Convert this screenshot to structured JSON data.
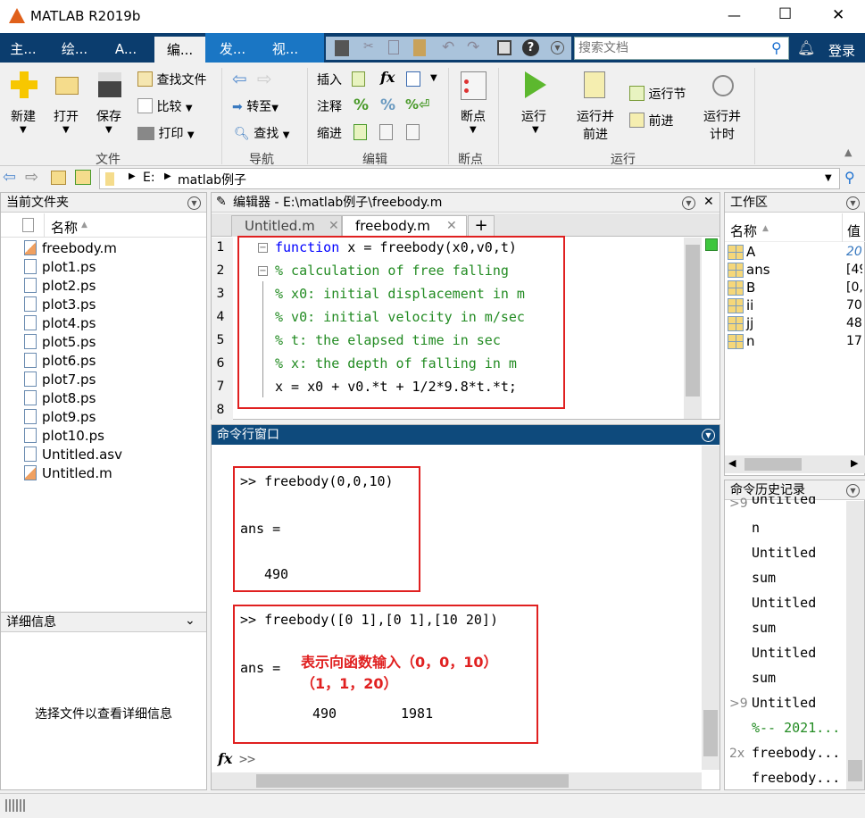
{
  "window": {
    "title": "MATLAB R2019b",
    "minimize": "—",
    "maximize": "☐",
    "close": "✕"
  },
  "tabs": [
    {
      "label": "主..."
    },
    {
      "label": "绘..."
    },
    {
      "label": "A..."
    },
    {
      "label": "编..."
    },
    {
      "label": "发..."
    },
    {
      "label": "视..."
    }
  ],
  "search": {
    "placeholder": "搜索文档"
  },
  "login": "登录",
  "ribbon": {
    "file": {
      "new": "新建",
      "open": "打开",
      "save": "保存",
      "find_files": "查找文件",
      "compare": "比较",
      "print": "打印",
      "group": "文件"
    },
    "nav": {
      "goto": "转至",
      "find": "查找",
      "group": "导航"
    },
    "edit": {
      "insert": "插入",
      "comment": "注释",
      "indent": "缩进",
      "group": "编辑"
    },
    "breakpoints": {
      "label": "断点",
      "group": "断点"
    },
    "run": {
      "run": "运行",
      "run_advance_1": "运行并",
      "run_advance_2": "前进",
      "run_section": "运行节",
      "advance": "前进",
      "run_time_1": "运行并",
      "run_time_2": "计时",
      "group": "运行"
    }
  },
  "address": {
    "drive": "E:",
    "folder": "matlab例子"
  },
  "current_folder": {
    "title": "当前文件夹",
    "column": "名称",
    "files": [
      "freebody.m",
      "plot1.ps",
      "plot2.ps",
      "plot3.ps",
      "plot4.ps",
      "plot5.ps",
      "plot6.ps",
      "plot7.ps",
      "plot8.ps",
      "plot9.ps",
      "plot10.ps",
      "Untitled.asv",
      "Untitled.m"
    ]
  },
  "details": {
    "title": "详细信息",
    "message": "选择文件以查看详细信息"
  },
  "editor": {
    "title": "编辑器 - E:\\matlab例子\\freebody.m",
    "tabs": [
      "Untitled.m",
      "freebody.m"
    ],
    "active_tab": 1,
    "lines": [
      {
        "n": "1",
        "kw": "function",
        "text": " x = freebody(x0,v0,t)"
      },
      {
        "n": "2",
        "text": "% calculation of free falling"
      },
      {
        "n": "3",
        "text": "% x0: initial displacement in m"
      },
      {
        "n": "4",
        "text": "% v0: initial velocity in m/sec"
      },
      {
        "n": "5",
        "text": "% t: the elapsed time in sec"
      },
      {
        "n": "6",
        "text": "% x: the depth of falling in m"
      },
      {
        "n": "7",
        "text": "x = x0 + v0.*t + 1/2*9.8*t.*t;"
      },
      {
        "n": "8",
        "text": ""
      }
    ]
  },
  "command_window": {
    "title": "命令行窗口",
    "cmd1": ">> freebody(0,0,10)",
    "ans1": "ans =",
    "val1": "490",
    "cmd2": ">> freebody([0 1],[0 1],[10 20])",
    "ans2": "ans =",
    "val2a": "490",
    "val2b": "1981",
    "annotation_1": "表示向函数输入（0，0，10）",
    "annotation_2": "（1，1，20）",
    "prompt": ">>",
    "fx": "fx"
  },
  "workspace": {
    "title": "工作区",
    "col_name": "名称",
    "col_value": "值",
    "vars": [
      {
        "name": "A",
        "value": "20"
      },
      {
        "name": "ans",
        "value": "[49"
      },
      {
        "name": "B",
        "value": "[0,"
      },
      {
        "name": "ii",
        "value": "70"
      },
      {
        "name": "jj",
        "value": "48"
      },
      {
        "name": "n",
        "value": "17"
      }
    ]
  },
  "history": {
    "title": "命令历史记录",
    "items": [
      {
        "mark": ">9",
        "text": "Untitled"
      },
      {
        "mark": "",
        "text": "n"
      },
      {
        "mark": "",
        "text": "Untitled"
      },
      {
        "mark": "",
        "text": "sum"
      },
      {
        "mark": "",
        "text": "Untitled"
      },
      {
        "mark": "",
        "text": "sum"
      },
      {
        "mark": "",
        "text": "Untitled"
      },
      {
        "mark": "",
        "text": "sum"
      },
      {
        "mark": ">9",
        "text": "Untitled"
      },
      {
        "mark": "",
        "text": "%-- 2021..."
      },
      {
        "mark": "2x",
        "text": "freebody..."
      },
      {
        "mark": "",
        "text": "freebody..."
      }
    ]
  },
  "colors": {
    "tab_bar": "#0b3d6e",
    "tab_bar_light": "#1a76c4",
    "comment": "#228b22",
    "keyword": "#0000ff",
    "annotation": "#e02020"
  }
}
